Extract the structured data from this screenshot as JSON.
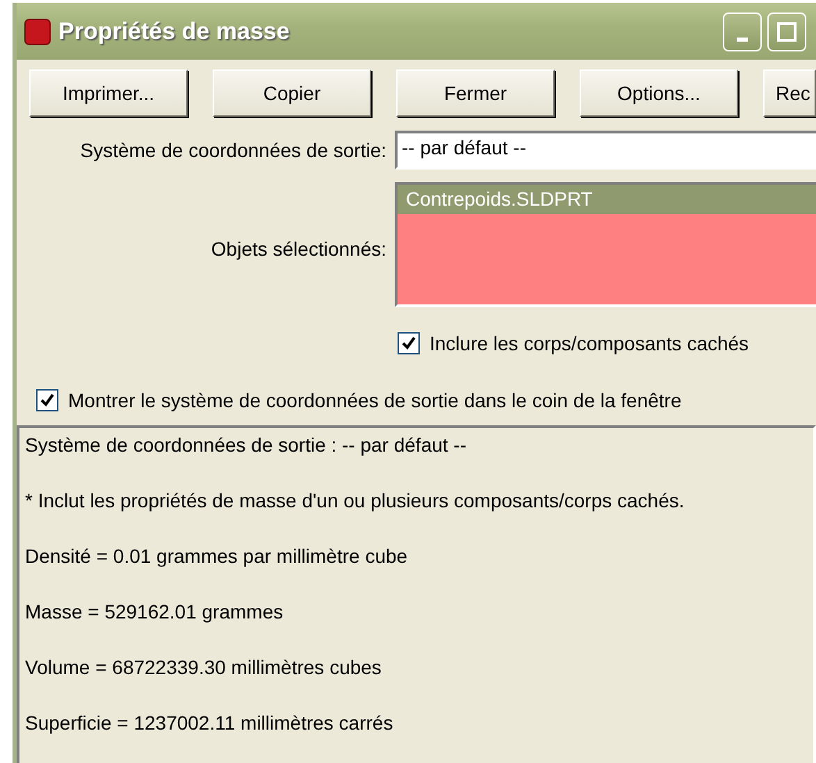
{
  "window": {
    "title": "Propriétés de masse"
  },
  "buttons": [
    "Imprimer...",
    "Copier",
    "Fermer",
    "Options...",
    "Rec"
  ],
  "output_coordinate_system": {
    "label": "Système de coordonnées de sortie:",
    "value": "-- par défaut --"
  },
  "selected_objects": {
    "label": "Objets sélectionnés:",
    "items": [
      {
        "text": "Contrepoids.SLDPRT",
        "selected": true
      }
    ]
  },
  "include_hidden": {
    "label": "Inclure les corps/composants cachés",
    "checked": true
  },
  "show_coordinate_system": {
    "label": "Montrer le système de coordonnées de sortie dans le coin de la fenêtre",
    "checked": true
  },
  "results": [
    "Système de coordonnées de sortie : -- par défaut --",
    "* Inclut les propriétés de masse d'un ou plusieurs composants/corps cachés.",
    "Densité = 0.01 grammes par millimètre cube",
    "Masse = 529162.01 grammes",
    "Volume = 68722339.30 millimètres cubes",
    "Superficie = 1237002.11 millimètres carrés"
  ]
}
